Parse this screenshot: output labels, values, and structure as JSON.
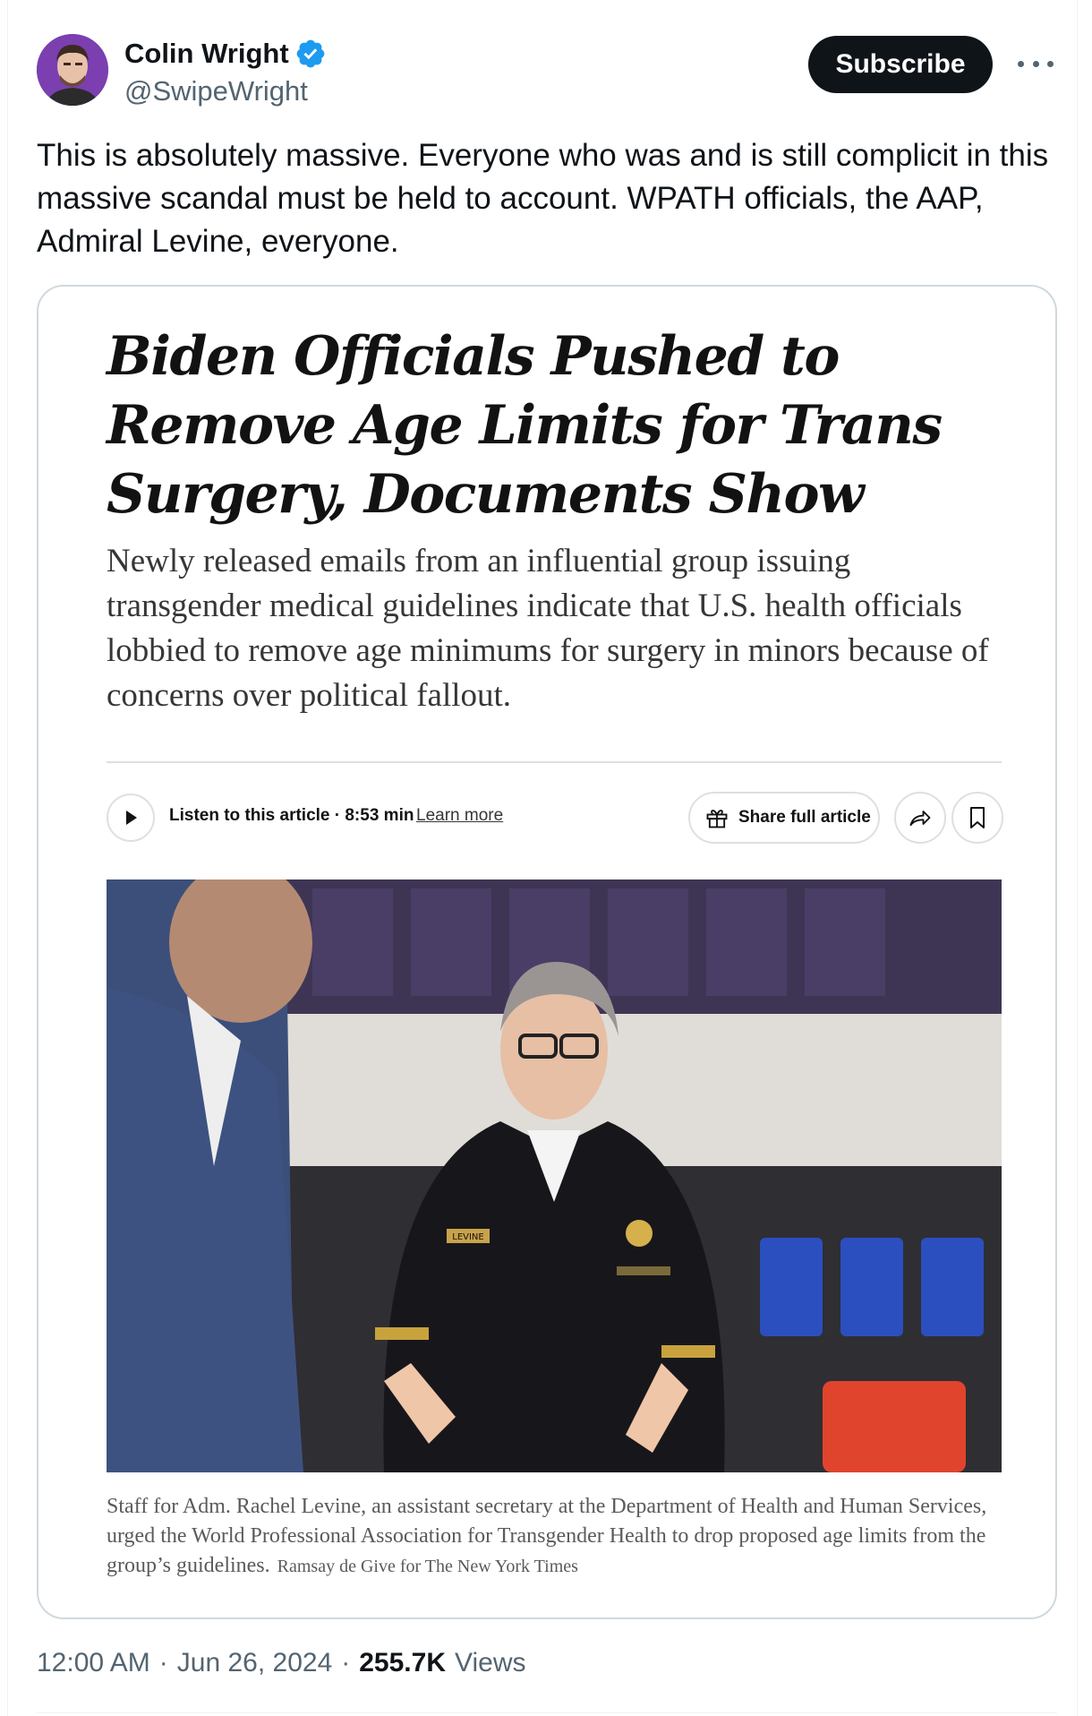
{
  "author": {
    "display_name": "Colin Wright",
    "handle": "@SwipeWright",
    "verified_color": "#1d9bf0"
  },
  "actions": {
    "subscribe_label": "Subscribe",
    "more_icon": "more-horizontal-icon"
  },
  "tweet": {
    "text": "This is absolutely massive. Everyone who was and is still complicit in this massive scandal must be held to account. WPATH officials, the AAP, Admiral Levine, everyone."
  },
  "article": {
    "headline": "Biden Officials Pushed to Remove Age Limits for Trans Surgery, Documents Show",
    "summary": "Newly released emails from an influential group issuing transgender medical guidelines indicate that U.S. health officials lobbied to remove age minimums for surgery in minors because of concerns over political fallout.",
    "listen_label": "Listen to this article · 8:53 min",
    "learn_more": "Learn more",
    "share_label": "Share full article",
    "caption": "Staff for Adm. Rachel Levine, an assistant secretary at the Department of Health and Human Services, urged the World Professional Association for Transgender Health to drop proposed age limits from the group’s guidelines.",
    "credit": "Ramsay de Give for The New York Times",
    "badge_text": "LEVINE"
  },
  "meta": {
    "time": "12:00 AM",
    "date": "Jun 26, 2024",
    "views_count": "255.7K",
    "views_label": "Views",
    "separator": "·"
  }
}
